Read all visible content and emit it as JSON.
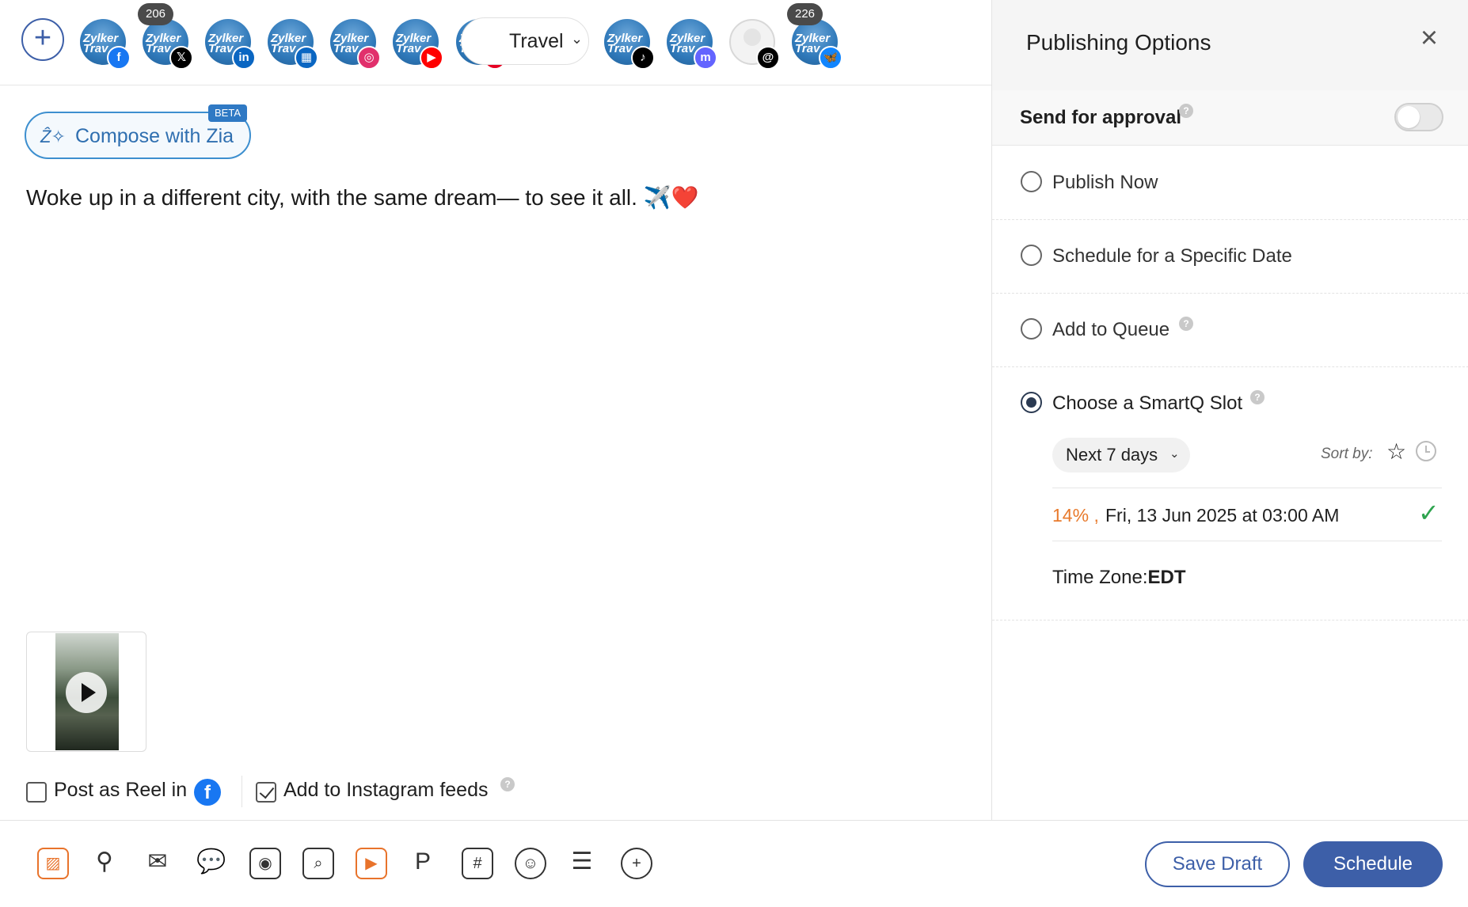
{
  "composer": {
    "accounts": [
      {
        "name": "Zylker Travel",
        "network": "facebook",
        "net_glyph": "f",
        "net_color": "#1877f2",
        "badge": ""
      },
      {
        "name": "Zylker Travel",
        "network": "x",
        "net_glyph": "𝕏",
        "net_color": "#000000",
        "badge": "206"
      },
      {
        "name": "Zylker Travel",
        "network": "linkedin",
        "net_glyph": "in",
        "net_color": "#0a66c2",
        "badge": ""
      },
      {
        "name": "Zylker Travel",
        "network": "linkedin-page",
        "net_glyph": "▦",
        "net_color": "#0a66c2",
        "badge": ""
      },
      {
        "name": "Zylker Travel",
        "network": "instagram",
        "net_glyph": "◎",
        "net_color": "#e1306c",
        "badge": ""
      },
      {
        "name": "Zylker Travel",
        "network": "youtube",
        "net_glyph": "▶",
        "net_color": "#ff0000",
        "badge": ""
      },
      {
        "name": "Zylker Travel",
        "network": "pinterest",
        "net_glyph": "P",
        "net_color": "#e60023",
        "badge": ""
      },
      {
        "name": "Zylker Travel",
        "network": "tiktok",
        "net_glyph": "♪",
        "net_color": "#000000",
        "badge": ""
      },
      {
        "name": "Zylker Travel",
        "network": "mastodon",
        "net_glyph": "m",
        "net_color": "#6364ff",
        "badge": ""
      },
      {
        "name": "",
        "network": "threads",
        "net_glyph": "@",
        "net_color": "#000000",
        "badge": ""
      },
      {
        "name": "Zylker Travel",
        "network": "bluesky",
        "net_glyph": "🦋",
        "net_color": "#1185fe",
        "badge": "226"
      }
    ],
    "avatar_text": "Zylker Trav",
    "group_label": "Travel",
    "zia": {
      "label": "Compose with Zia",
      "badge": "BETA"
    },
    "post_text": "Woke up in a different city, with the same dream— to see it all. ✈️❤️",
    "options": {
      "reel_label": "Post as Reel in",
      "reel_checked": false,
      "ig_feed_label": "Add to Instagram feeds",
      "ig_feed_checked": true,
      "help_glyph": "?"
    }
  },
  "toolbar": {
    "tools": [
      {
        "name": "image-icon",
        "glyph": "▨"
      },
      {
        "name": "location-icon",
        "glyph": "⚲"
      },
      {
        "name": "first-comment-icon",
        "glyph": "✉"
      },
      {
        "name": "comment-icon",
        "glyph": "💬"
      },
      {
        "name": "camera-icon",
        "glyph": "◉"
      },
      {
        "name": "search-image-icon",
        "glyph": "⌕"
      },
      {
        "name": "video-settings-icon",
        "glyph": "▶"
      },
      {
        "name": "pinterest-icon",
        "glyph": "P"
      },
      {
        "name": "hashtag-icon",
        "glyph": "#"
      },
      {
        "name": "emoji-icon",
        "glyph": "☺"
      },
      {
        "name": "list-icon",
        "glyph": "☰"
      },
      {
        "name": "add-more-icon",
        "glyph": "+"
      }
    ],
    "save_draft_label": "Save Draft",
    "schedule_label": "Schedule"
  },
  "panel": {
    "title": "Publishing Options",
    "close_glyph": "×",
    "approval_label": "Send for approval",
    "approval_on": false,
    "options": [
      {
        "label": "Publish Now",
        "selected": false,
        "help": false
      },
      {
        "label": "Schedule for a Specific Date",
        "selected": false,
        "help": false
      },
      {
        "label": "Add to Queue",
        "selected": false,
        "help": true
      },
      {
        "label": "Choose a SmartQ Slot",
        "selected": true,
        "help": true
      }
    ],
    "smartq": {
      "range_label": "Next 7 days",
      "sort_label": "Sort by:",
      "slot_percent": "14%",
      "slot_sep": ",",
      "slot_time": "Fri, 13 Jun 2025 at 03:00 AM",
      "timezone_label": "Time Zone:",
      "timezone_value": "EDT"
    }
  },
  "colors": {
    "primary": "#3d5fa8",
    "accent_orange": "#e87a2c",
    "success_green": "#2ea44f",
    "zia_blue": "#2f6fb0"
  }
}
